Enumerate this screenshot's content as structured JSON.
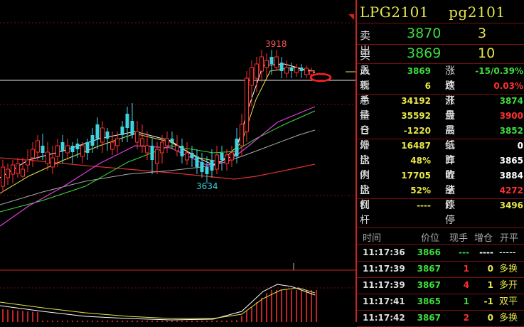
{
  "chart": {
    "high_label": "3918",
    "low_label": "3634"
  },
  "header": {
    "code1": "LPG2101",
    "code2": "pg2101"
  },
  "bidask": {
    "sell_label": "卖出",
    "sell_price": "3870",
    "sell_vol": "3",
    "buy_label": "买入",
    "buy_price": "3869",
    "buy_vol": "10"
  },
  "quote": {
    "rows": [
      {
        "l1": "最新",
        "v1": "3869",
        "c1": "green",
        "l2": "涨跌",
        "v2": "-15/0.39%",
        "c2": "green"
      },
      {
        "l1": "现手",
        "v1": "6",
        "c1": "yellow",
        "l2": "速涨",
        "v2": "0.03%",
        "c2": "red"
      },
      {
        "l1": "总量",
        "v1": "34192",
        "c1": "yellow",
        "l2": "开盘",
        "v2": "3874",
        "c2": "green"
      },
      {
        "l1": "持仓",
        "v1": "35592",
        "c1": "yellow",
        "l2": "最高",
        "v2": "3900",
        "c2": "red"
      },
      {
        "l1": "日增",
        "v1": "-1220",
        "c1": "yellow",
        "l2": "最低",
        "v2": "3852",
        "c2": "green"
      },
      {
        "l1": "外盘",
        "v1": "16487",
        "c1": "yellow",
        "l2": "结算价",
        "v2": "0",
        "c2": "white"
      },
      {
        "l1": "比例",
        "v1": "48%",
        "c1": "yellow",
        "l2": "昨收",
        "v2": "3865",
        "c2": "white"
      },
      {
        "l1": "内盘",
        "v1": "17705",
        "c1": "yellow",
        "l2": "昨结",
        "v2": "3884",
        "c2": "white"
      },
      {
        "l1": "比例",
        "v1": "52%",
        "c1": "yellow",
        "l2": "涨停",
        "v2": "4272",
        "c2": "red"
      },
      {
        "l1": "杠杆",
        "v1": "----",
        "c1": "yellow",
        "l2": "跌停",
        "v2": "3496",
        "c2": "yellow"
      }
    ]
  },
  "ticks": {
    "headers": {
      "time": "时间",
      "price": "价位",
      "vol": "现手",
      "inc": "增仓",
      "kind": "开平"
    },
    "rows": [
      {
        "time": "11:17:36",
        "price": "3866",
        "vol": "---",
        "inc": "----",
        "kind": "-----",
        "pc": "green",
        "vc": "green",
        "ic": "white",
        "kc": "white"
      },
      {
        "time": "11:17:39",
        "price": "3867",
        "vol": "1",
        "inc": "0",
        "kind": "多换",
        "pc": "green",
        "vc": "red",
        "ic": "yellow",
        "kc": "yellow"
      },
      {
        "time": "11:17:39",
        "price": "3867",
        "vol": "4",
        "inc": "1",
        "kind": "多开",
        "pc": "green",
        "vc": "red",
        "ic": "yellow",
        "kc": "yellow"
      },
      {
        "time": "11:17:41",
        "price": "3865",
        "vol": "1",
        "inc": "-1",
        "kind": "双平",
        "pc": "green",
        "vc": "green",
        "ic": "yellow",
        "kc": "yellow"
      },
      {
        "time": "11:17:42",
        "price": "3867",
        "vol": "2",
        "inc": "0",
        "kind": "多换",
        "pc": "green",
        "vc": "red",
        "ic": "yellow",
        "kc": "yellow"
      }
    ]
  }
}
